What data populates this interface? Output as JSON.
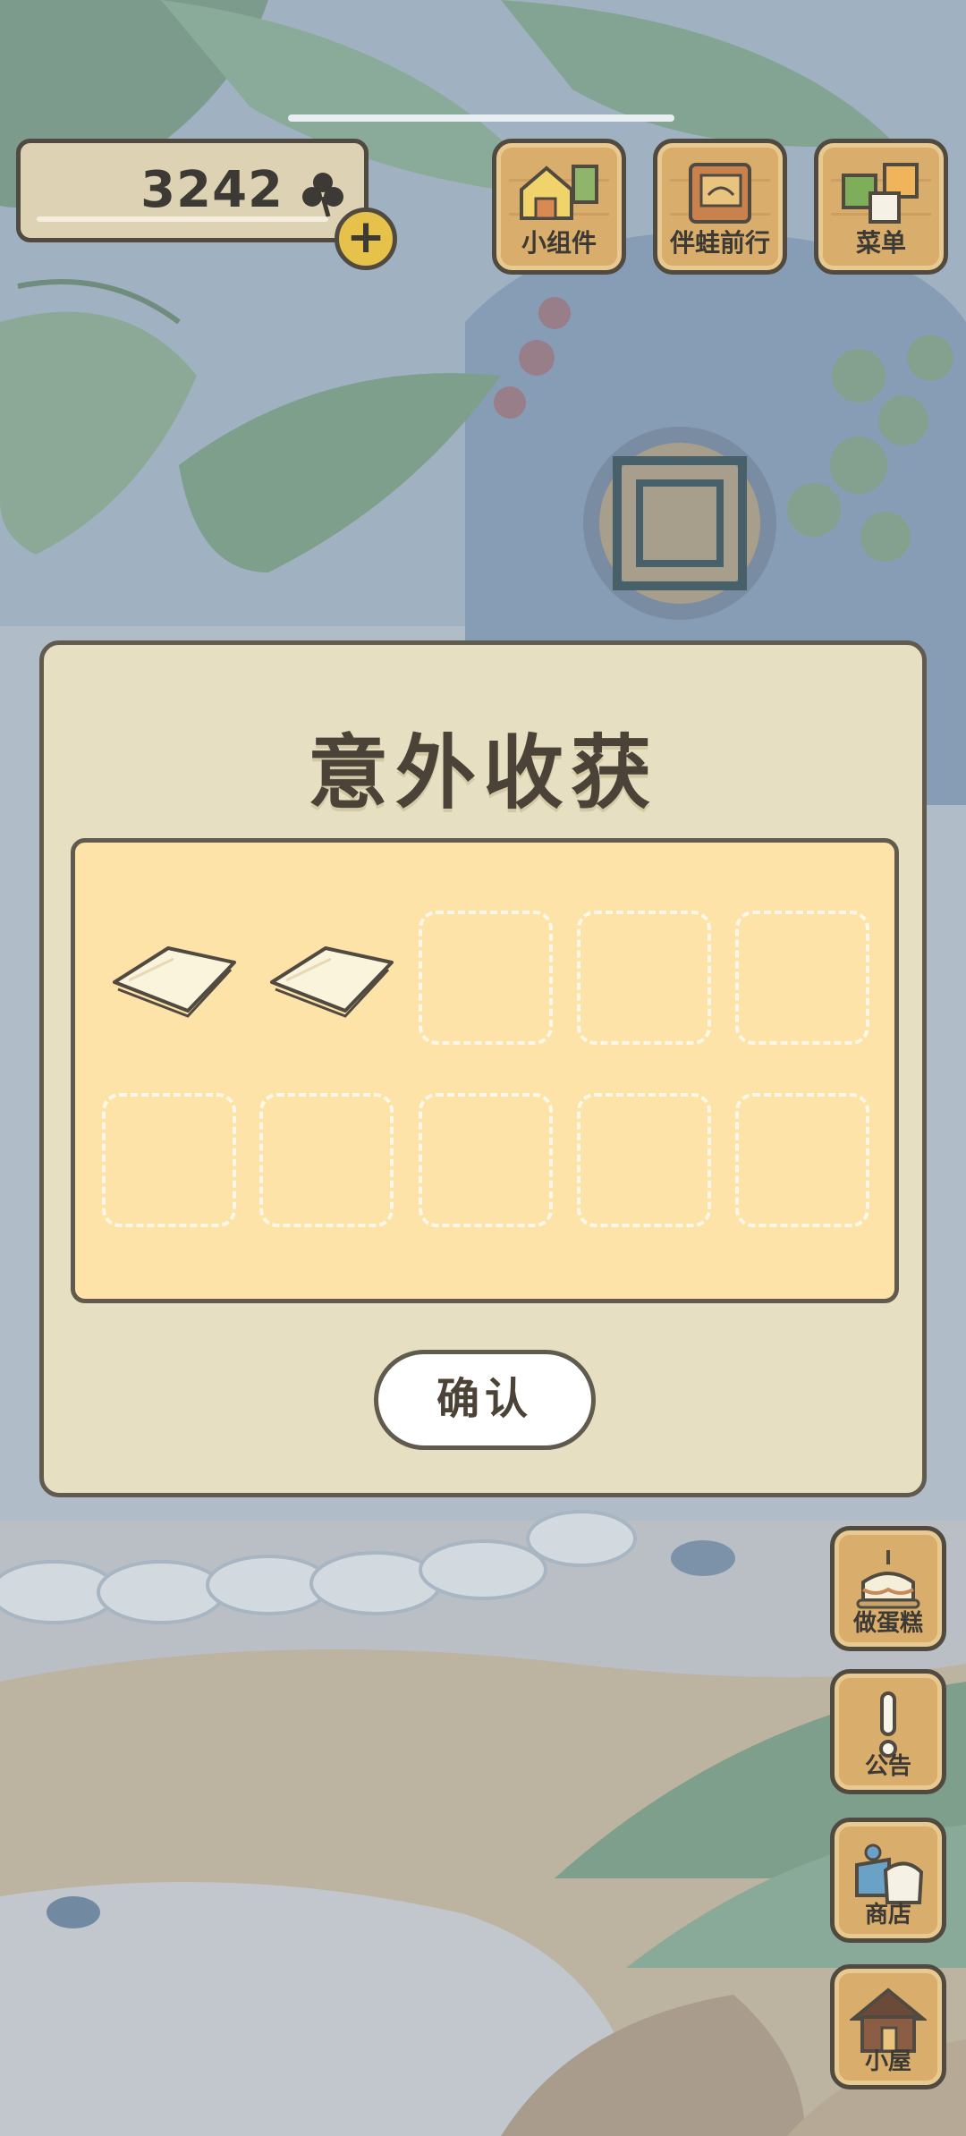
{
  "hud": {
    "clover_count": "3242",
    "plus_label": "+",
    "buttons": [
      {
        "label": "小组件",
        "icon": "widget-icon"
      },
      {
        "label": "伴蛙前行",
        "icon": "notebook-icon"
      },
      {
        "label": "菜单",
        "icon": "menu-icon"
      }
    ]
  },
  "dialog": {
    "title": "意外收获",
    "items": [
      {
        "filled": true,
        "icon": "paper-icon"
      },
      {
        "filled": true,
        "icon": "paper-icon"
      },
      {
        "filled": false
      },
      {
        "filled": false
      },
      {
        "filled": false
      },
      {
        "filled": false
      },
      {
        "filled": false
      },
      {
        "filled": false
      },
      {
        "filled": false
      },
      {
        "filled": false
      }
    ],
    "confirm_label": "确认"
  },
  "side_buttons": [
    {
      "label": "做蛋糕",
      "icon": "cake-icon"
    },
    {
      "label": "公告",
      "icon": "exclamation-icon"
    },
    {
      "label": "商店",
      "icon": "shop-bags-icon"
    },
    {
      "label": "小屋",
      "icon": "house-icon"
    }
  ],
  "colors": {
    "wood": "#d9ad6b",
    "dialog_bg": "#e7dfc1",
    "panel_bg": "#fde3a8",
    "outline": "#514a40",
    "coin": "#e7c24a"
  }
}
